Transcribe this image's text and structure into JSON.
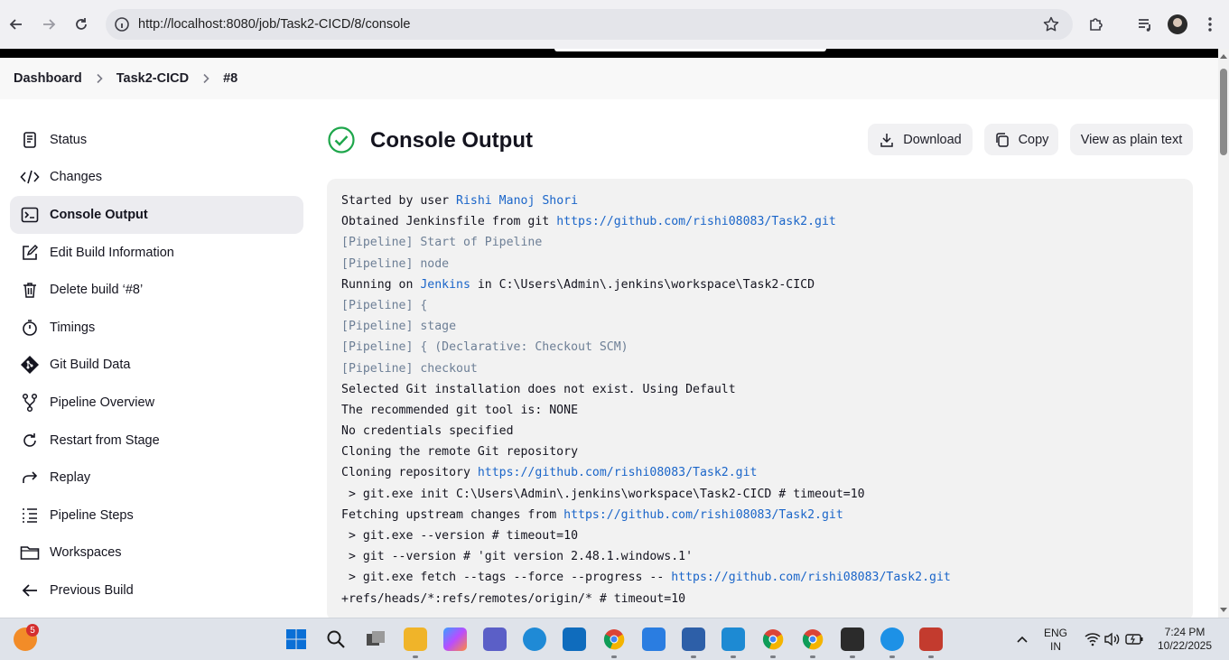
{
  "browser": {
    "url": "http://localhost:8080/job/Task2-CICD/8/console"
  },
  "breadcrumb": {
    "items": [
      "Dashboard",
      "Task2-CICD",
      "#8"
    ]
  },
  "sidebar": {
    "items": [
      {
        "label": "Status",
        "icon": "status-icon"
      },
      {
        "label": "Changes",
        "icon": "code-icon"
      },
      {
        "label": "Console Output",
        "icon": "terminal-icon",
        "active": true
      },
      {
        "label": "Edit Build Information",
        "icon": "edit-icon"
      },
      {
        "label": "Delete build ‘#8’",
        "icon": "trash-icon"
      },
      {
        "label": "Timings",
        "icon": "stopwatch-icon"
      },
      {
        "label": "Git Build Data",
        "icon": "git-icon"
      },
      {
        "label": "Pipeline Overview",
        "icon": "branch-icon"
      },
      {
        "label": "Restart from Stage",
        "icon": "restart-icon"
      },
      {
        "label": "Replay",
        "icon": "replay-icon"
      },
      {
        "label": "Pipeline Steps",
        "icon": "list-icon"
      },
      {
        "label": "Workspaces",
        "icon": "folder-icon"
      },
      {
        "label": "Previous Build",
        "icon": "arrow-left-icon"
      }
    ]
  },
  "main": {
    "title": "Console Output",
    "status_icon": "success-check-icon",
    "status_color": "#1ea64b",
    "buttons": {
      "download": "Download",
      "copy": "Copy",
      "plain_text": "View as plain text"
    }
  },
  "console": {
    "lines": [
      {
        "parts": [
          {
            "t": "Started by user "
          },
          {
            "t": "Rishi Manoj Shori",
            "link": true
          }
        ]
      },
      {
        "parts": [
          {
            "t": "Obtained Jenkinsfile from git "
          },
          {
            "t": "https://github.com/rishi08083/Task2.git",
            "link": true
          }
        ]
      },
      {
        "pipeline": true,
        "parts": [
          {
            "t": "[Pipeline] Start of Pipeline"
          }
        ]
      },
      {
        "pipeline": true,
        "parts": [
          {
            "t": "[Pipeline] node"
          }
        ]
      },
      {
        "parts": [
          {
            "t": "Running on "
          },
          {
            "t": "Jenkins",
            "link": true
          },
          {
            "t": " in C:\\Users\\Admin\\.jenkins\\workspace\\Task2-CICD"
          }
        ]
      },
      {
        "pipeline": true,
        "parts": [
          {
            "t": "[Pipeline] {"
          }
        ]
      },
      {
        "pipeline": true,
        "parts": [
          {
            "t": "[Pipeline] stage"
          }
        ]
      },
      {
        "pipeline": true,
        "parts": [
          {
            "t": "[Pipeline] { (Declarative: Checkout SCM)"
          }
        ]
      },
      {
        "pipeline": true,
        "parts": [
          {
            "t": "[Pipeline] checkout"
          }
        ]
      },
      {
        "parts": [
          {
            "t": "Selected Git installation does not exist. Using Default"
          }
        ]
      },
      {
        "parts": [
          {
            "t": "The recommended git tool is: NONE"
          }
        ]
      },
      {
        "parts": [
          {
            "t": "No credentials specified"
          }
        ]
      },
      {
        "parts": [
          {
            "t": "Cloning the remote Git repository"
          }
        ]
      },
      {
        "parts": [
          {
            "t": "Cloning repository "
          },
          {
            "t": "https://github.com/rishi08083/Task2.git",
            "link": true
          }
        ]
      },
      {
        "parts": [
          {
            "t": " > git.exe init C:\\Users\\Admin\\.jenkins\\workspace\\Task2-CICD # timeout=10"
          }
        ]
      },
      {
        "parts": [
          {
            "t": "Fetching upstream changes from "
          },
          {
            "t": "https://github.com/rishi08083/Task2.git",
            "link": true
          }
        ]
      },
      {
        "parts": [
          {
            "t": " > git.exe --version # timeout=10"
          }
        ]
      },
      {
        "parts": [
          {
            "t": " > git --version # 'git version 2.48.1.windows.1'"
          }
        ]
      },
      {
        "parts": [
          {
            "t": " > git.exe fetch --tags --force --progress -- "
          },
          {
            "t": "https://github.com/rishi08083/Task2.git",
            "link": true
          }
        ]
      },
      {
        "parts": [
          {
            "t": "+refs/heads/*:refs/remotes/origin/* # timeout=10"
          }
        ]
      }
    ]
  },
  "taskbar": {
    "notification_count": "5",
    "language": "ENG",
    "region": "IN",
    "time": "7:24 PM",
    "date": "10/22/2025"
  }
}
